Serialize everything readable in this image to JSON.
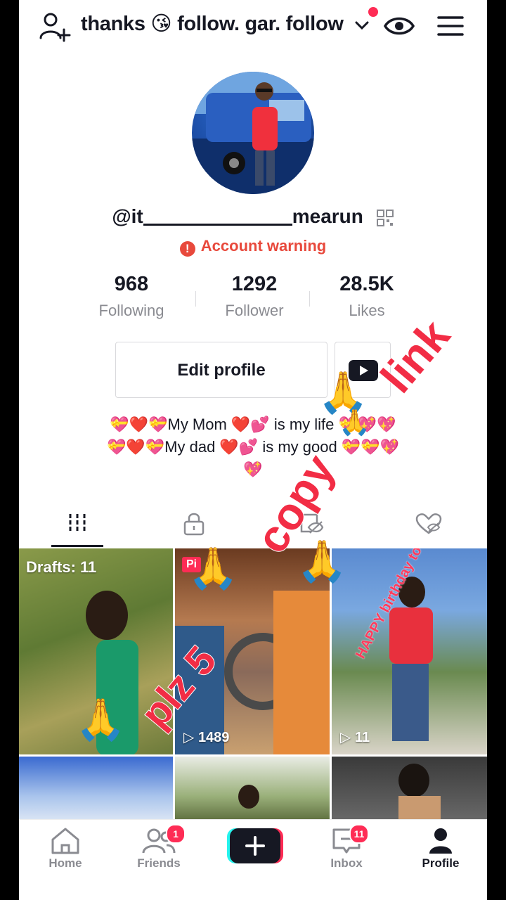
{
  "header": {
    "title": "thanks 😘 follow. gar. follow"
  },
  "profile": {
    "username_start": "@it",
    "username_end": "mearun",
    "warning": "Account warning",
    "stats": [
      {
        "value": "968",
        "label": "Following"
      },
      {
        "value": "1292",
        "label": "Follower"
      },
      {
        "value": "28.5K",
        "label": "Likes"
      }
    ],
    "edit_label": "Edit profile",
    "bio_line1": "💝❤️💝My Mom ❤️💕 is my life 💝💖💖",
    "bio_line2": "💝❤️💝My dad ❤️💕 is my good 💝💝💖",
    "bio_line3": "💖"
  },
  "grid": [
    {
      "label": "Drafts: 11"
    },
    {
      "badge": "Pi",
      "views": "1489"
    },
    {
      "views": "11",
      "caption": "HAPPY birthday to you"
    }
  ],
  "overlay": {
    "copy": "copy",
    "link": "link",
    "plz": "plz 5"
  },
  "nav": {
    "items": [
      {
        "label": "Home"
      },
      {
        "label": "Friends",
        "badge": "1"
      },
      {
        "label": "Inbox",
        "badge": "11"
      },
      {
        "label": "Profile"
      }
    ]
  },
  "colors": {
    "accent": "#fe2c55",
    "warning": "#e8493c",
    "text": "#161823",
    "muted": "#8a8b91"
  }
}
